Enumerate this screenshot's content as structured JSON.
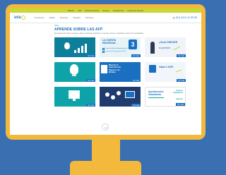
{
  "topbar": {
    "links": [
      "Afiliados",
      "Cetir",
      "Razón Recolector",
      "Pensión",
      "Transparencia",
      "Canales de Atención"
    ]
  },
  "header": {
    "logo_text": "ura",
    "nav": [
      "Conócenos",
      "Afiliate",
      "Empresa",
      "Trámites",
      "Servicios"
    ],
    "phone": "(01) 4411-11 55 55"
  },
  "content": {
    "breadcrumb": "Inicio",
    "title": "APRENDE SOBRE LAS AFP",
    "intro": "Encuentra todo sobre pensiones, ahorro voluntario, jubilación y más para conocer y planificar tu futuro con tranquilidad."
  },
  "cards": [
    {
      "label": "Ver más"
    },
    {
      "title_line1": "LA CUENTA",
      "title_line2": "INDIVIDUAL",
      "badge": "3",
      "options": [
        "Cuenta de Edad Independiente (CEI)",
        "Cuenta de Participación (CDP)"
      ],
      "label": "Ver más"
    },
    {
      "title_line1": "¿Será",
      "title_line2": "CRECER",
      "title_line3": "la pensión",
      "label": "Ver más"
    },
    {
      "label": "Ver más"
    },
    {
      "title_line1": "Mejorar la",
      "title_line2": "inversión de",
      "title_line3": "Seguros de",
      "title_line4": "Rentas",
      "label": "Ver más"
    },
    {
      "title": "edad 1:1997",
      "label": "Ver más"
    },
    {
      "label": "Ver más"
    },
    {
      "label": "Ver más"
    },
    {
      "title_line1": "Aportaciones",
      "title_line2": "Voluntarias",
      "sub1_line1": "Aportes",
      "sub1_line2": "Voluntarios",
      "sub2": "Aportes",
      "label": "Ver más"
    }
  ],
  "icons": {
    "phone": "phone-icon",
    "scroll_up": "chevron-up-icon"
  },
  "colors": {
    "accent_blue": "#1a6fc0",
    "lime": "#c7d934",
    "teal": "#0ea3a8",
    "monitor": "#f3b93c",
    "background": "#3a6fb1"
  }
}
